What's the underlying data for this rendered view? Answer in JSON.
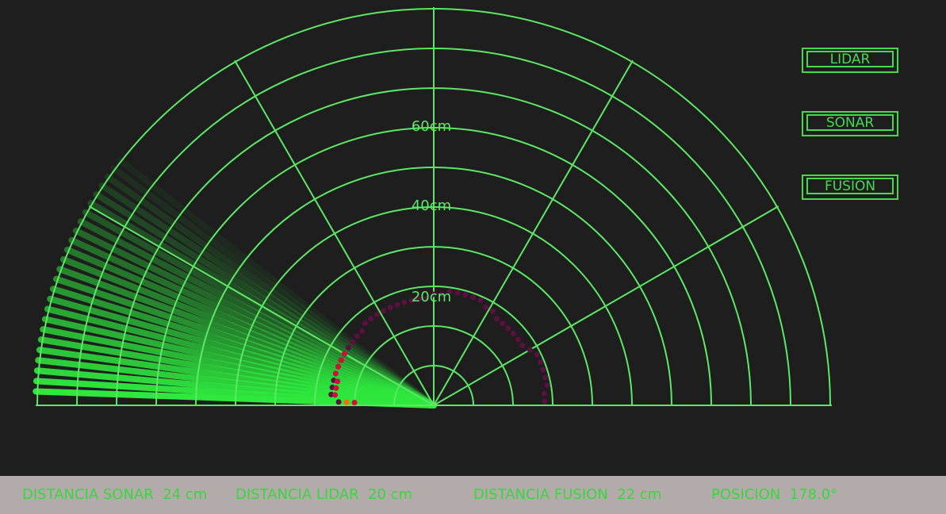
{
  "colors": {
    "background": "#1e1e1e",
    "grid": "#5ce865",
    "sweep": "#2ee83e",
    "sonar_points": "#5a1040",
    "lidar_points": "#d0103a",
    "fusion_point": "#ff6a00",
    "status_bar": "#b3aba9",
    "status_text": "#34d93a"
  },
  "radar": {
    "range_labels": [
      "20cm",
      "40cm",
      "60cm"
    ],
    "max_range_cm": 100,
    "current_angle_deg": 178.0,
    "sonar_points": [
      {
        "angle": 2,
        "dist": 28
      },
      {
        "angle": 6,
        "dist": 28
      },
      {
        "angle": 10,
        "dist": 29
      },
      {
        "angle": 14,
        "dist": 29
      },
      {
        "angle": 18,
        "dist": 29
      },
      {
        "angle": 22,
        "dist": 29
      },
      {
        "angle": 26,
        "dist": 29
      },
      {
        "angle": 30,
        "dist": 28
      },
      {
        "angle": 34,
        "dist": 27
      },
      {
        "angle": 38,
        "dist": 27
      },
      {
        "angle": 42,
        "dist": 27
      },
      {
        "angle": 46,
        "dist": 27
      },
      {
        "angle": 50,
        "dist": 27
      },
      {
        "angle": 54,
        "dist": 27
      },
      {
        "angle": 58,
        "dist": 28
      },
      {
        "angle": 62,
        "dist": 28
      },
      {
        "angle": 66,
        "dist": 29
      },
      {
        "angle": 70,
        "dist": 29
      },
      {
        "angle": 74,
        "dist": 29
      },
      {
        "angle": 78,
        "dist": 29
      },
      {
        "angle": 82,
        "dist": 29
      },
      {
        "angle": 86,
        "dist": 28
      },
      {
        "angle": 90,
        "dist": 28
      },
      {
        "angle": 94,
        "dist": 27
      },
      {
        "angle": 98,
        "dist": 27
      },
      {
        "angle": 102,
        "dist": 27
      },
      {
        "angle": 106,
        "dist": 27
      },
      {
        "angle": 110,
        "dist": 27
      },
      {
        "angle": 114,
        "dist": 27
      },
      {
        "angle": 118,
        "dist": 27
      },
      {
        "angle": 122,
        "dist": 27
      },
      {
        "angle": 126,
        "dist": 27
      },
      {
        "angle": 130,
        "dist": 27
      },
      {
        "angle": 134,
        "dist": 26
      },
      {
        "angle": 138,
        "dist": 26
      },
      {
        "angle": 142,
        "dist": 26
      },
      {
        "angle": 146,
        "dist": 26
      },
      {
        "angle": 150,
        "dist": 26
      },
      {
        "angle": 154,
        "dist": 26
      },
      {
        "angle": 158,
        "dist": 26
      },
      {
        "angle": 162,
        "dist": 26
      },
      {
        "angle": 166,
        "dist": 26
      },
      {
        "angle": 170,
        "dist": 26
      },
      {
        "angle": 174,
        "dist": 26
      },
      {
        "angle": 178,
        "dist": 24
      }
    ],
    "lidar_points": [
      {
        "angle": 150,
        "dist": 26
      },
      {
        "angle": 154,
        "dist": 26
      },
      {
        "angle": 158,
        "dist": 26
      },
      {
        "angle": 162,
        "dist": 26
      },
      {
        "angle": 166,
        "dist": 25
      },
      {
        "angle": 170,
        "dist": 25
      },
      {
        "angle": 174,
        "dist": 25
      },
      {
        "angle": 178,
        "dist": 20
      }
    ],
    "fusion_point": {
      "angle": 178,
      "dist": 22
    }
  },
  "buttons": {
    "lidar": "LIDAR",
    "sonar": "SONAR",
    "fusion": "FUSION"
  },
  "status": {
    "sonar": "DISTANCIA SONAR  24 cm",
    "lidar": "DISTANCIA LIDAR  20 cm",
    "fusion": "DISTANCIA FUSION  22 cm",
    "position": "POSICION  178.0°"
  }
}
